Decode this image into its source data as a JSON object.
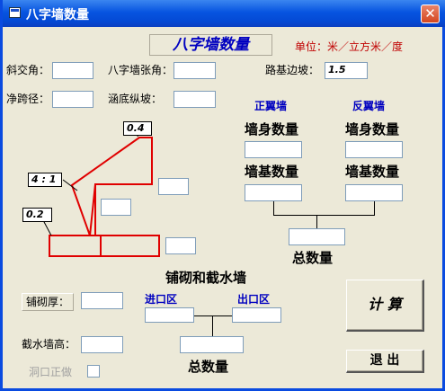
{
  "window": {
    "title": "八字墙数量"
  },
  "banner": {
    "title": "八字墙数量",
    "unit": "单位：米／立方米／度"
  },
  "fields": {
    "skew_angle": {
      "label": "斜交角：",
      "value": ""
    },
    "wing_angle": {
      "label": "八字墙张角：",
      "value": ""
    },
    "embank_slope": {
      "label": "路基边坡：",
      "value": "1.5"
    },
    "clear_span": {
      "label": "净跨径：",
      "value": ""
    },
    "culvert_slope": {
      "label": "涵底纵坡：",
      "value": ""
    }
  },
  "diagram": {
    "dim_top": "0.4",
    "dim_slope": "4 : 1",
    "dim_base": "0.2"
  },
  "wall": {
    "forward_title": "正翼墙",
    "reverse_title": "反翼墙",
    "body_qty": "墙身数量",
    "base_qty": "墙基数量",
    "total_qty": "总数量"
  },
  "paving": {
    "title": "铺砌和截水墙",
    "thickness_label": "铺砌厚：",
    "cutoff_height_label": "截水墙高：",
    "mouth_label": "洞口正做",
    "inlet": "进口区",
    "outlet": "出口区",
    "total_qty": "总数量"
  },
  "buttons": {
    "calculate": "计  算",
    "exit": "退  出"
  }
}
